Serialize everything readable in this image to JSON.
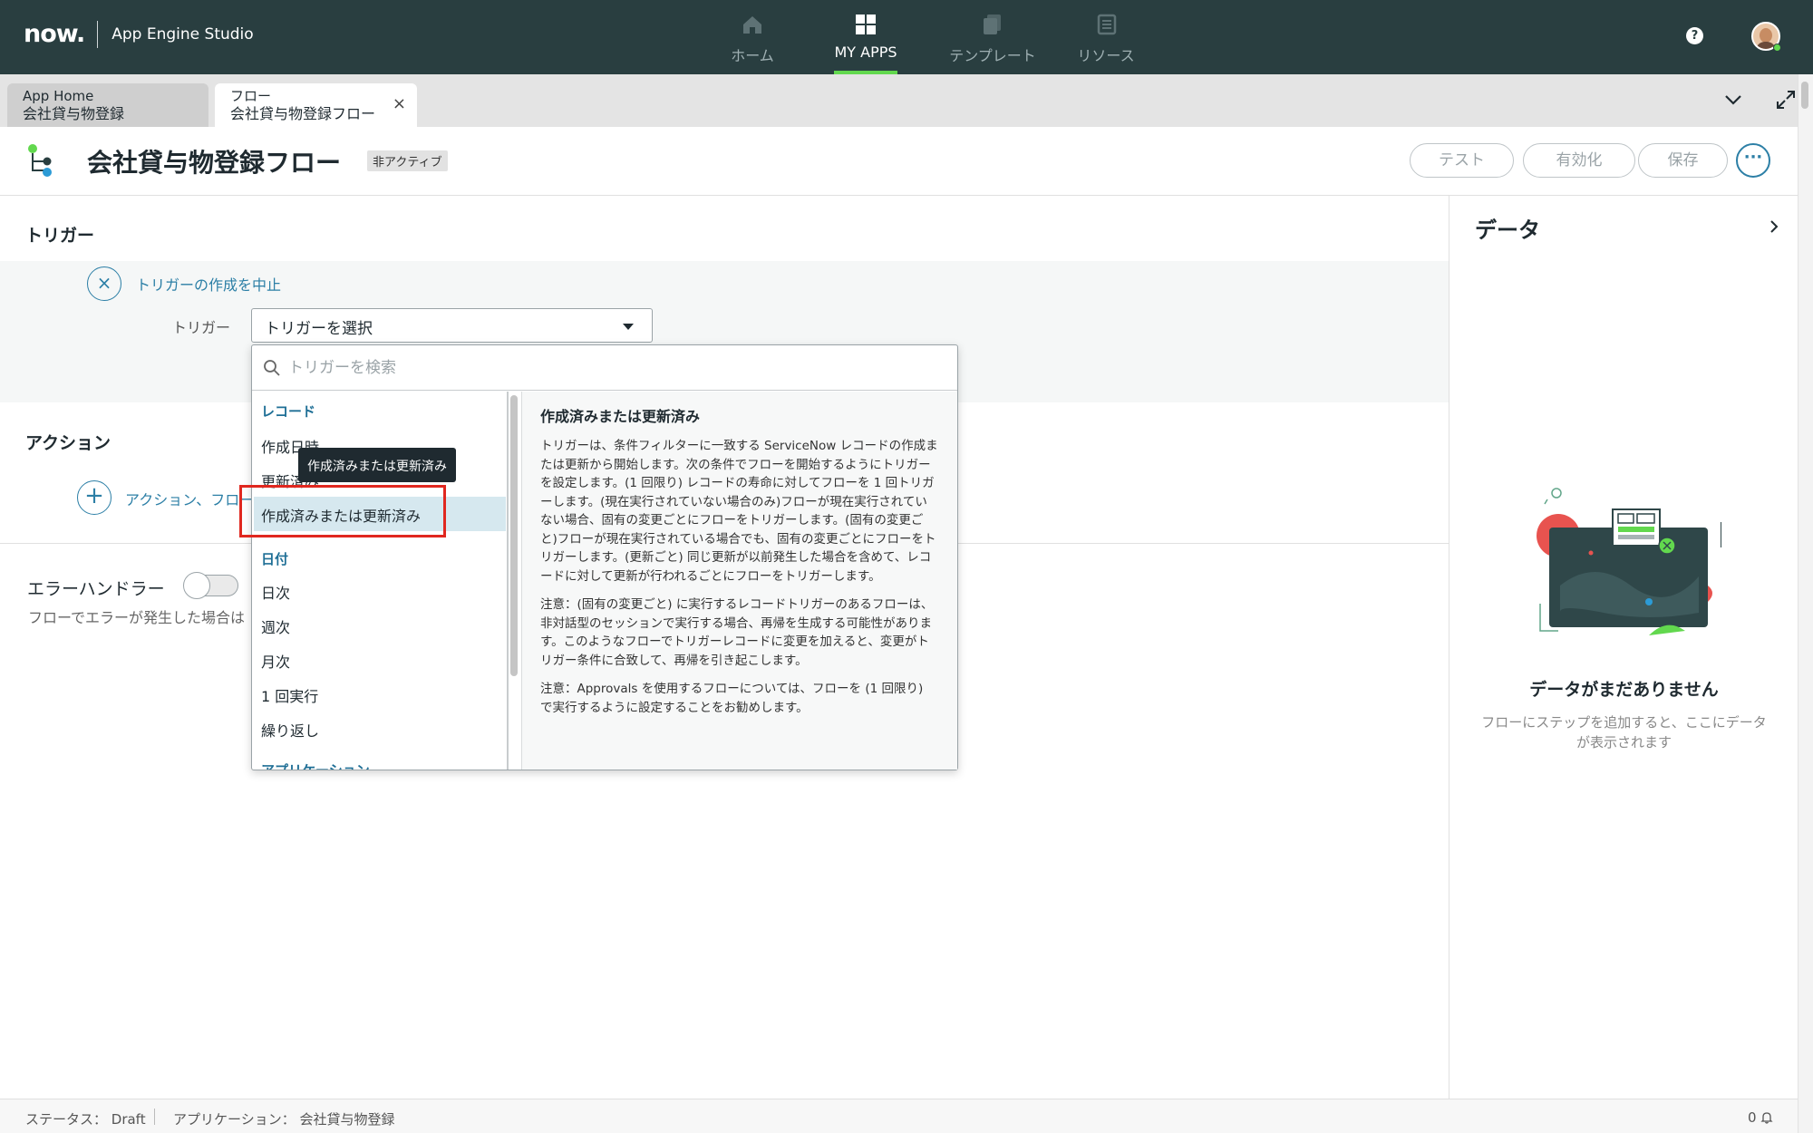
{
  "topnav": {
    "logo": "now.",
    "app_name": "App Engine Studio",
    "items": [
      {
        "label": "ホーム",
        "icon": "home-icon"
      },
      {
        "label": "MY APPS",
        "icon": "grid-icon",
        "active": true
      },
      {
        "label": "テンプレート",
        "icon": "template-icon"
      },
      {
        "label": "リソース",
        "icon": "resource-icon"
      }
    ],
    "help": "?"
  },
  "tabs": [
    {
      "line1": "App Home",
      "line2": "会社貸与物登録"
    },
    {
      "line1": "フロー",
      "line2": "会社貸与物登録フロー",
      "close": "×"
    }
  ],
  "header": {
    "title": "会社貸与物登録フロー",
    "badge": "非アクティブ",
    "buttons": {
      "test": "テスト",
      "activate": "有効化",
      "save": "保存"
    },
    "more": "···"
  },
  "trigger": {
    "section_title": "トリガー",
    "cancel_icon": "×",
    "cancel_link": "トリガーの作成を中止",
    "label": "トリガー",
    "select_value": "トリガーを選択"
  },
  "dropdown": {
    "search_placeholder": "トリガーを検索",
    "groups": [
      {
        "label": "レコード",
        "items": [
          "作成日時",
          "更新済み",
          "作成済みまたは更新済み"
        ]
      },
      {
        "label": "日付",
        "items": [
          "日次",
          "週次",
          "月次",
          "1 回実行",
          "繰り返し"
        ]
      },
      {
        "label": "アプリケーション",
        "items": []
      }
    ],
    "selected": "作成済みまたは更新済み",
    "tooltip": "作成済みまたは更新済み",
    "description": {
      "title": "作成済みまたは更新済み",
      "p1": "トリガーは、条件フィルターに一致する ServiceNow レコードの作成または更新から開始します。次の条件でフローを開始するようにトリガーを設定します。(1 回限り) レコードの寿命に対してフローを 1 回トリガーします。(現在実行されていない場合のみ)フローが現在実行されていない場合、固有の変更ごとにフローをトリガーします。(固有の変更ごと)フローが現在実行されている場合でも、固有の変更ごとにフローをトリガーします。(更新ごと) 同じ更新が以前発生した場合を含めて、レコードに対して更新が行われるごとにフローをトリガーします。",
      "p2": "注意：(固有の変更ごと) に実行するレコードトリガーのあるフローは、非対話型のセッションで実行する場合、再帰を生成する可能性があります。このようなフローでトリガーレコードに変更を加えると、変更がトリガー条件に合致して、再帰を引き起こします。",
      "p3": "注意：Approvals を使用するフローについては、フローを (1 回限り) で実行するように設定することをお勧めします。"
    }
  },
  "actions": {
    "section_title": "アクション",
    "add_icon": "+",
    "add_link": "アクション、フロー"
  },
  "error_handler": {
    "label": "エラーハンドラー",
    "description": "フローでエラーが発生した場合は"
  },
  "data_panel": {
    "title": "データ",
    "empty_title": "データがまだありません",
    "empty_desc": "フローにステップを追加すると、ここにデータが表示されます"
  },
  "footer": {
    "status": "ステータス： Draft",
    "application": "アプリケーション： 会社貸与物登録",
    "notifications": "0"
  }
}
